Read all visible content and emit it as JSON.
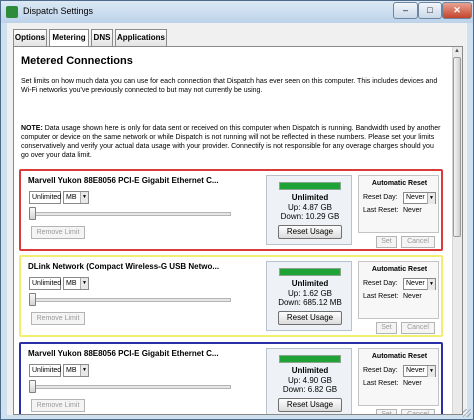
{
  "window": {
    "title": "Dispatch Settings",
    "close_glyph": "✕",
    "max_glyph": "□",
    "min_glyph": "–"
  },
  "tabs": [
    {
      "label": "Options"
    },
    {
      "label": "Metering"
    },
    {
      "label": "DNS"
    },
    {
      "label": "Applications"
    }
  ],
  "active_tab": "Metering",
  "page": {
    "heading": "Metered Connections",
    "intro": "Set limits on how much data you can use for each connection that Dispatch has ever seen on this computer. This includes devices and Wi-Fi networks you've previously connected to but may not currently be using.",
    "note_label": "NOTE:",
    "note": " Data usage shown here is only for data sent or received on this computer when Dispatch is running. Bandwidth used by another computer or device on the same network or while Dispatch is not running will not be reflected in these numbers. Please set your limits conservatively and verify your actual data usage with your provider. Connectify is not responsible for any overage charges should you go over your data limit."
  },
  "connections": [
    {
      "name": "Marvell Yukon 88E8056 PCI-E Gigabit Ethernet C...",
      "border_color": "#d93a3a",
      "limit": "Unlimited",
      "unit": "MB",
      "remove_label": "Remove Limit",
      "usage_fraction": 1.0,
      "usage_status": "Unlimited",
      "up": "Up: 4.87 GB",
      "down": "Down: 10.29 GB",
      "reset_usage_label": "Reset Usage",
      "auto_reset_title": "Automatic Reset",
      "reset_day_label": "Reset Day:",
      "reset_day": "Never",
      "last_reset_label": "Last Reset:",
      "last_reset": "Never",
      "set_label": "Set",
      "cancel_label": "Cancel"
    },
    {
      "name": "DLink Network (Compact Wireless-G USB Netwo...",
      "border_color": "#f2ee70",
      "limit": "Unlimited",
      "unit": "MB",
      "remove_label": "Remove Limit",
      "usage_fraction": 1.0,
      "usage_status": "Unlimited",
      "up": "Up: 1.62 GB",
      "down": "Down: 685.12 MB",
      "reset_usage_label": "Reset Usage",
      "auto_reset_title": "Automatic Reset",
      "reset_day_label": "Reset Day:",
      "reset_day": "Never",
      "last_reset_label": "Last Reset:",
      "last_reset": "Never",
      "set_label": "Set",
      "cancel_label": "Cancel"
    },
    {
      "name": "Marvell Yukon 88E8056 PCI-E Gigabit Ethernet C...",
      "border_color": "#2b2fa8",
      "limit": "Unlimited",
      "unit": "MB",
      "remove_label": "Remove Limit",
      "usage_fraction": 1.0,
      "usage_status": "Unlimited",
      "up": "Up: 4.90 GB",
      "down": "Down: 6.82 GB",
      "reset_usage_label": "Reset Usage",
      "auto_reset_title": "Automatic Reset",
      "reset_day_label": "Reset Day:",
      "reset_day": "Never",
      "last_reset_label": "Last Reset:",
      "last_reset": "Never",
      "set_label": "Set",
      "cancel_label": "Cancel"
    }
  ],
  "colors": {
    "usage_green": "#1fa336"
  }
}
